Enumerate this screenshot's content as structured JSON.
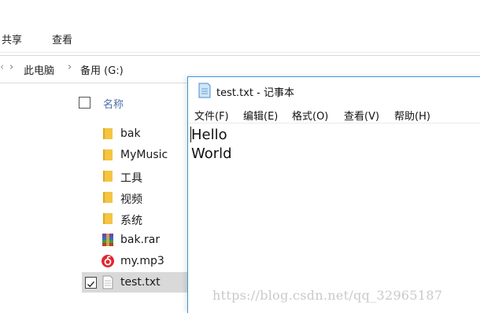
{
  "ribbon": {
    "tabs": [
      "共享",
      "查看"
    ]
  },
  "address": {
    "items": [
      "此电脑",
      "备用 (G:)"
    ]
  },
  "filelist": {
    "column_name": "名称",
    "rows": [
      {
        "label": "bak",
        "icon": "folder-icon"
      },
      {
        "label": "MyMusic",
        "icon": "folder-icon"
      },
      {
        "label": "工具",
        "icon": "folder-icon"
      },
      {
        "label": "视频",
        "icon": "folder-icon"
      },
      {
        "label": "系统",
        "icon": "folder-icon"
      },
      {
        "label": "bak.rar",
        "icon": "rar-archive-icon"
      },
      {
        "label": "my.mp3",
        "icon": "netease-music-icon"
      },
      {
        "label": "test.txt",
        "icon": "text-file-icon",
        "selected": true
      }
    ]
  },
  "notepad": {
    "title": "test.txt - 记事本",
    "menus": [
      "文件(F)",
      "编辑(E)",
      "格式(O)",
      "查看(V)",
      "帮助(H)"
    ],
    "content_lines": [
      "Hello",
      "World"
    ]
  },
  "watermark": "https://blog.csdn.net/qq_32965187",
  "colors": {
    "folder": "#f4c542",
    "accent": "#3a96dd",
    "selected_row": "#d9d9d9"
  }
}
